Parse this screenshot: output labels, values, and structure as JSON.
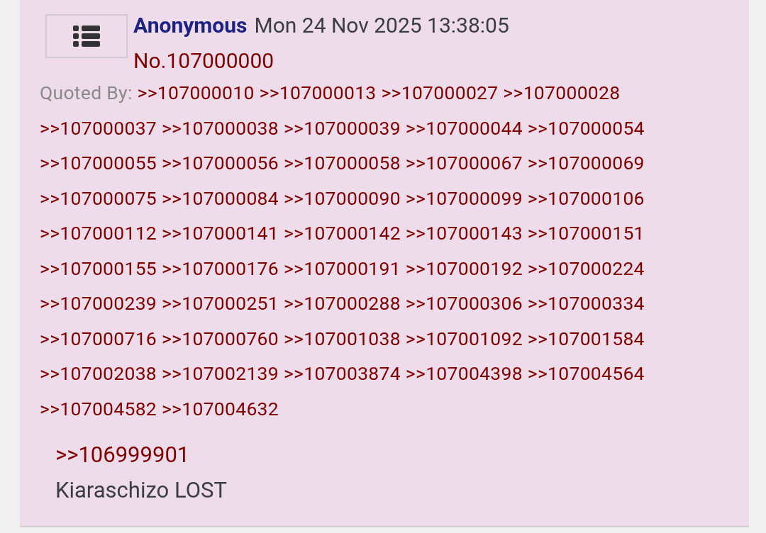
{
  "post": {
    "name": "Anonymous",
    "date": "Mon 24 Nov 2025 13:38:05",
    "number": "No.107000000",
    "quoted_by_label": "Quoted By:",
    "quoted_by": [
      ">>107000010",
      ">>107000013",
      ">>107000027",
      ">>107000028",
      ">>107000037",
      ">>107000038",
      ">>107000039",
      ">>107000044",
      ">>107000054",
      ">>107000055",
      ">>107000056",
      ">>107000058",
      ">>107000067",
      ">>107000069",
      ">>107000075",
      ">>107000084",
      ">>107000090",
      ">>107000099",
      ">>107000106",
      ">>107000112",
      ">>107000141",
      ">>107000142",
      ">>107000143",
      ">>107000151",
      ">>107000155",
      ">>107000176",
      ">>107000191",
      ">>107000192",
      ">>107000224",
      ">>107000239",
      ">>107000251",
      ">>107000288",
      ">>107000306",
      ">>107000334",
      ">>107000716",
      ">>107000760",
      ">>107001038",
      ">>107001092",
      ">>107001584",
      ">>107002038",
      ">>107002139",
      ">>107003874",
      ">>107004398",
      ">>107004564",
      ">>107004582",
      ">>107004632"
    ],
    "body": [
      {
        "kind": "quote",
        "text": ">>106999901"
      },
      {
        "kind": "text",
        "text": "Kiaraschizo LOST"
      }
    ]
  }
}
